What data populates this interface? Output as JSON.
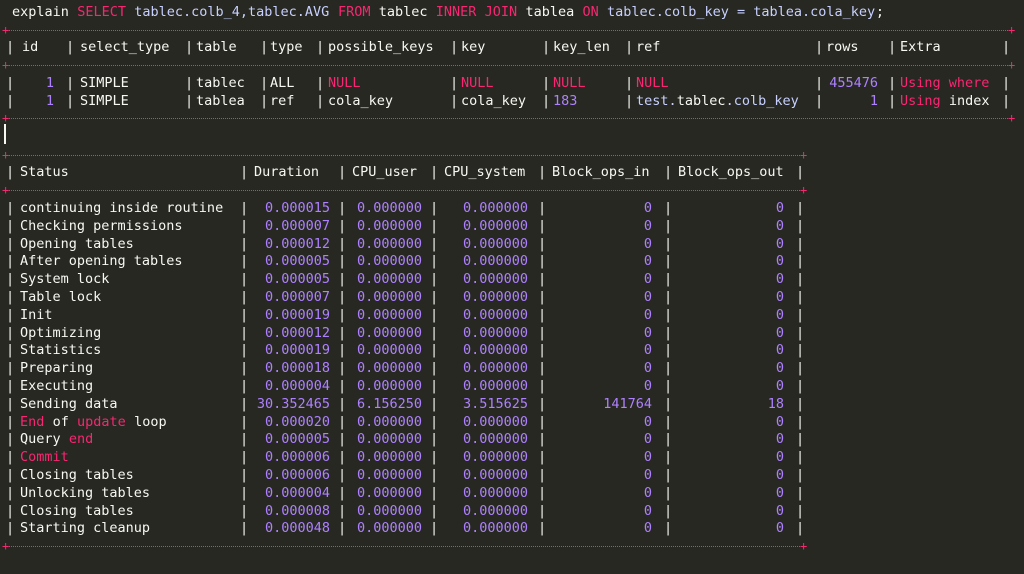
{
  "query": {
    "parts": [
      {
        "t": "explain ",
        "c": "white"
      },
      {
        "t": "SELECT ",
        "c": "pink"
      },
      {
        "t": "tablec.colb_4,tablec.AVG ",
        "c": "blue"
      },
      {
        "t": "FROM ",
        "c": "pink"
      },
      {
        "t": "tablec ",
        "c": "white"
      },
      {
        "t": "INNER JOIN ",
        "c": "pink"
      },
      {
        "t": "tablea ",
        "c": "white"
      },
      {
        "t": "ON ",
        "c": "pink"
      },
      {
        "t": "tablec.colb_key = tablea.cola_key",
        "c": "blue"
      },
      {
        "t": ";",
        "c": "white"
      }
    ]
  },
  "explain": {
    "headers": [
      "id",
      "select_type",
      "table",
      "type",
      "possible_keys",
      "key",
      "key_len",
      "ref",
      "rows",
      "Extra"
    ],
    "rows": [
      {
        "id": "1",
        "select_type": "SIMPLE",
        "table": "tablec",
        "type": "ALL",
        "possible_keys": "NULL",
        "key": "NULL",
        "key_len": "NULL",
        "ref_a": "NULL",
        "ref_b": "",
        "ref_c": "",
        "rows": "455476",
        "extra_a": "Using where",
        "extra_b": ""
      },
      {
        "id": "1",
        "select_type": "SIMPLE",
        "table": "tablea",
        "type": "ref",
        "possible_keys": "cola_key",
        "key": "cola_key",
        "key_len": "183",
        "ref_a": "test.",
        "ref_b": "tablec",
        "ref_c": ".colb_key",
        "rows": "1",
        "extra_a": "Using",
        "extra_b": " index"
      }
    ]
  },
  "profile": {
    "headers": [
      "Status",
      "Duration",
      "CPU_user",
      "CPU_system",
      "Block_ops_in",
      "Block_ops_out"
    ],
    "rows": [
      {
        "s": [
          {
            "t": "continuing inside routine",
            "c": "white"
          }
        ],
        "d": "0.000015",
        "u": "0.000000",
        "sy": "0.000000",
        "bi": "0",
        "bo": "0"
      },
      {
        "s": [
          {
            "t": "Checking permissions",
            "c": "white"
          }
        ],
        "d": "0.000007",
        "u": "0.000000",
        "sy": "0.000000",
        "bi": "0",
        "bo": "0"
      },
      {
        "s": [
          {
            "t": "Opening tables",
            "c": "white"
          }
        ],
        "d": "0.000012",
        "u": "0.000000",
        "sy": "0.000000",
        "bi": "0",
        "bo": "0"
      },
      {
        "s": [
          {
            "t": "After opening tables",
            "c": "white"
          }
        ],
        "d": "0.000005",
        "u": "0.000000",
        "sy": "0.000000",
        "bi": "0",
        "bo": "0"
      },
      {
        "s": [
          {
            "t": "System lock",
            "c": "white"
          }
        ],
        "d": "0.000005",
        "u": "0.000000",
        "sy": "0.000000",
        "bi": "0",
        "bo": "0"
      },
      {
        "s": [
          {
            "t": "Table lock",
            "c": "white"
          }
        ],
        "d": "0.000007",
        "u": "0.000000",
        "sy": "0.000000",
        "bi": "0",
        "bo": "0"
      },
      {
        "s": [
          {
            "t": "Init",
            "c": "white"
          }
        ],
        "d": "0.000019",
        "u": "0.000000",
        "sy": "0.000000",
        "bi": "0",
        "bo": "0"
      },
      {
        "s": [
          {
            "t": "Optimizing",
            "c": "white"
          }
        ],
        "d": "0.000012",
        "u": "0.000000",
        "sy": "0.000000",
        "bi": "0",
        "bo": "0"
      },
      {
        "s": [
          {
            "t": "Statistics",
            "c": "white"
          }
        ],
        "d": "0.000019",
        "u": "0.000000",
        "sy": "0.000000",
        "bi": "0",
        "bo": "0"
      },
      {
        "s": [
          {
            "t": "Preparing",
            "c": "white"
          }
        ],
        "d": "0.000018",
        "u": "0.000000",
        "sy": "0.000000",
        "bi": "0",
        "bo": "0"
      },
      {
        "s": [
          {
            "t": "Executing",
            "c": "white"
          }
        ],
        "d": "0.000004",
        "u": "0.000000",
        "sy": "0.000000",
        "bi": "0",
        "bo": "0"
      },
      {
        "s": [
          {
            "t": "Sending data",
            "c": "white"
          }
        ],
        "d": "30.352465",
        "u": "6.156250",
        "sy": "3.515625",
        "bi": "141764",
        "bo": "18"
      },
      {
        "s": [
          {
            "t": "End",
            "c": "pink"
          },
          {
            "t": " of ",
            "c": "white"
          },
          {
            "t": "update",
            "c": "pink"
          },
          {
            "t": " loop",
            "c": "white"
          }
        ],
        "d": "0.000020",
        "u": "0.000000",
        "sy": "0.000000",
        "bi": "0",
        "bo": "0"
      },
      {
        "s": [
          {
            "t": "Query ",
            "c": "white"
          },
          {
            "t": "end",
            "c": "pink"
          }
        ],
        "d": "0.000005",
        "u": "0.000000",
        "sy": "0.000000",
        "bi": "0",
        "bo": "0"
      },
      {
        "s": [
          {
            "t": "Commit",
            "c": "pink"
          }
        ],
        "d": "0.000006",
        "u": "0.000000",
        "sy": "0.000000",
        "bi": "0",
        "bo": "0"
      },
      {
        "s": [
          {
            "t": "Closing tables",
            "c": "white"
          }
        ],
        "d": "0.000006",
        "u": "0.000000",
        "sy": "0.000000",
        "bi": "0",
        "bo": "0"
      },
      {
        "s": [
          {
            "t": "Unlocking tables",
            "c": "white"
          }
        ],
        "d": "0.000004",
        "u": "0.000000",
        "sy": "0.000000",
        "bi": "0",
        "bo": "0"
      },
      {
        "s": [
          {
            "t": "Closing tables",
            "c": "white"
          }
        ],
        "d": "0.000008",
        "u": "0.000000",
        "sy": "0.000000",
        "bi": "0",
        "bo": "0"
      },
      {
        "s": [
          {
            "t": "Starting cleanup",
            "c": "white"
          }
        ],
        "d": "0.000048",
        "u": "0.000000",
        "sy": "0.000000",
        "bi": "0",
        "bo": "0"
      }
    ]
  },
  "colors": {
    "background": "#272822",
    "text": "#f8f8f2",
    "keyword": "#f92672",
    "number": "#ae81ff",
    "identifier": "#c7d0ff",
    "border": "#75715e"
  }
}
